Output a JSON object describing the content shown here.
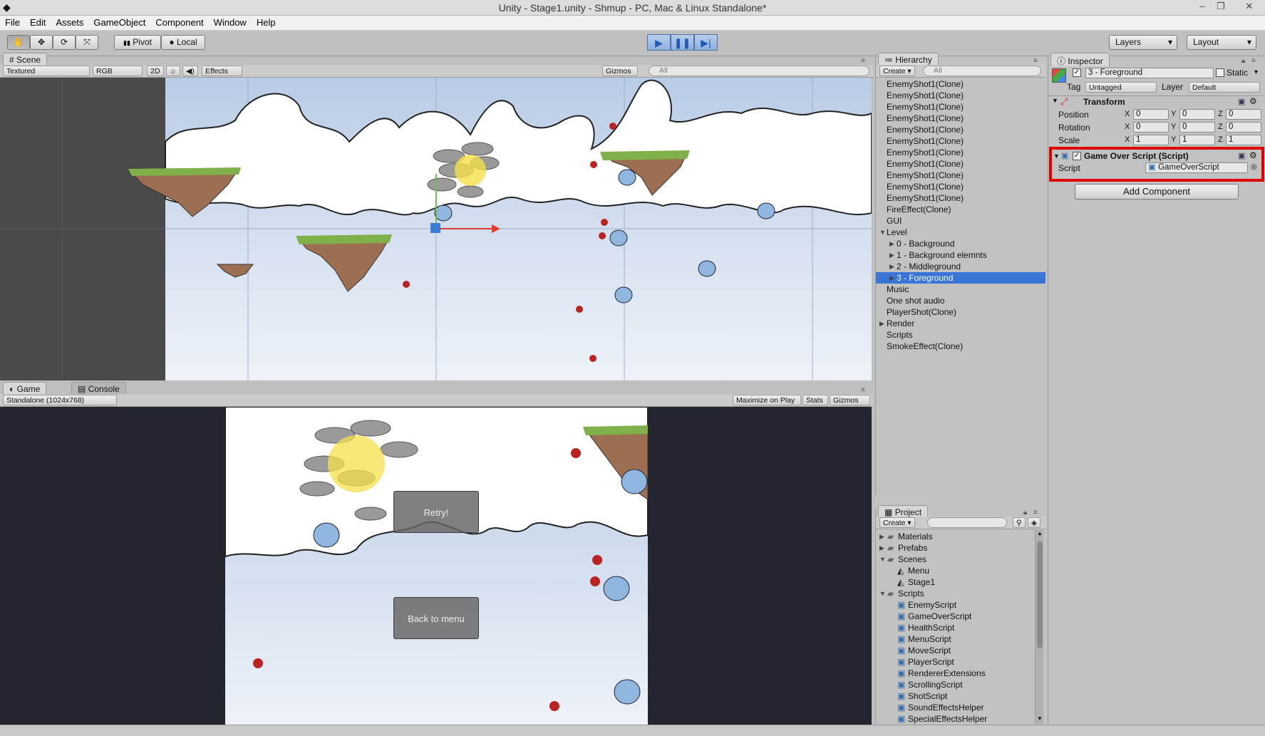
{
  "window": {
    "title": "Unity - Stage1.unity - Shmup - PC, Mac & Linux Standalone*"
  },
  "menu": [
    "File",
    "Edit",
    "Assets",
    "GameObject",
    "Component",
    "Window",
    "Help"
  ],
  "toolbar": {
    "pivot": "Pivot",
    "local": "Local",
    "layers": "Layers",
    "layout": "Layout"
  },
  "scene": {
    "tab": "Scene",
    "render_mode": "Textured",
    "color_mode": "RGB",
    "mode_2d": "2D",
    "effects": "Effects",
    "gizmos": "Gizmos",
    "search_placeholder": "All"
  },
  "game": {
    "tab": "Game",
    "console_tab": "Console",
    "resolution": "Standalone (1024x768)",
    "maximize": "Maximize on Play",
    "stats": "Stats",
    "gizmos": "Gizmos",
    "retry": "Retry!",
    "back": "Back to menu"
  },
  "hierarchy": {
    "tab": "Hierarchy",
    "create": "Create",
    "search_placeholder": "All",
    "items": [
      {
        "label": "EnemyShot1(Clone)",
        "indent": 0
      },
      {
        "label": "EnemyShot1(Clone)",
        "indent": 0
      },
      {
        "label": "EnemyShot1(Clone)",
        "indent": 0
      },
      {
        "label": "EnemyShot1(Clone)",
        "indent": 0
      },
      {
        "label": "EnemyShot1(Clone)",
        "indent": 0
      },
      {
        "label": "EnemyShot1(Clone)",
        "indent": 0
      },
      {
        "label": "EnemyShot1(Clone)",
        "indent": 0
      },
      {
        "label": "EnemyShot1(Clone)",
        "indent": 0
      },
      {
        "label": "EnemyShot1(Clone)",
        "indent": 0
      },
      {
        "label": "EnemyShot1(Clone)",
        "indent": 0
      },
      {
        "label": "EnemyShot1(Clone)",
        "indent": 0
      },
      {
        "label": "FireEffect(Clone)",
        "indent": 0
      },
      {
        "label": "GUI",
        "indent": 0
      },
      {
        "label": "Level",
        "indent": 0,
        "expanded": true
      },
      {
        "label": "0 - Background",
        "indent": 1,
        "collapsed": true
      },
      {
        "label": "1 - Background elemnts",
        "indent": 1,
        "collapsed": true
      },
      {
        "label": "2 - Middleground",
        "indent": 1,
        "collapsed": true
      },
      {
        "label": "3 - Foreground",
        "indent": 1,
        "collapsed": true,
        "selected": true
      },
      {
        "label": "Music",
        "indent": 0
      },
      {
        "label": "One shot audio",
        "indent": 0
      },
      {
        "label": "PlayerShot(Clone)",
        "indent": 0
      },
      {
        "label": "Render",
        "indent": 0,
        "collapsed": true
      },
      {
        "label": "Scripts",
        "indent": 0
      },
      {
        "label": "SmokeEffect(Clone)",
        "indent": 0
      }
    ]
  },
  "project": {
    "tab": "Project",
    "create": "Create",
    "items": [
      {
        "label": "Materials",
        "type": "folder",
        "indent": 0,
        "collapsed": true
      },
      {
        "label": "Prefabs",
        "type": "folder",
        "indent": 0,
        "collapsed": true
      },
      {
        "label": "Scenes",
        "type": "folder",
        "indent": 0,
        "expanded": true
      },
      {
        "label": "Menu",
        "type": "scene",
        "indent": 1
      },
      {
        "label": "Stage1",
        "type": "scene",
        "indent": 1
      },
      {
        "label": "Scripts",
        "type": "folder",
        "indent": 0,
        "expanded": true
      },
      {
        "label": "EnemyScript",
        "type": "script",
        "indent": 1
      },
      {
        "label": "GameOverScript",
        "type": "script",
        "indent": 1
      },
      {
        "label": "HealthScript",
        "type": "script",
        "indent": 1
      },
      {
        "label": "MenuScript",
        "type": "script",
        "indent": 1
      },
      {
        "label": "MoveScript",
        "type": "script",
        "indent": 1
      },
      {
        "label": "PlayerScript",
        "type": "script",
        "indent": 1
      },
      {
        "label": "RendererExtensions",
        "type": "script",
        "indent": 1
      },
      {
        "label": "ScrollingScript",
        "type": "script",
        "indent": 1
      },
      {
        "label": "ShotScript",
        "type": "script",
        "indent": 1
      },
      {
        "label": "SoundEffectsHelper",
        "type": "script",
        "indent": 1
      },
      {
        "label": "SpecialEffectsHelper",
        "type": "script",
        "indent": 1
      }
    ]
  },
  "inspector": {
    "tab": "Inspector",
    "object_name": "3 - Foreground",
    "static": "Static",
    "tag_label": "Tag",
    "tag": "Untagged",
    "layer_label": "Layer",
    "layer": "Default",
    "transform": {
      "title": "Transform",
      "position": {
        "label": "Position",
        "x": "0",
        "y": "0",
        "z": "0"
      },
      "rotation": {
        "label": "Rotation",
        "x": "0",
        "y": "0",
        "z": "0"
      },
      "scale": {
        "label": "Scale",
        "x": "1",
        "y": "1",
        "z": "1"
      }
    },
    "script_component": {
      "title": "Game Over Script (Script)",
      "script_label": "Script",
      "script": "GameOverScript"
    },
    "add_component": "Add Component",
    "axis": {
      "x": "X",
      "y": "Y",
      "z": "Z"
    }
  },
  "colors": {
    "selection": "#3875d7",
    "highlight_box": "#e00000",
    "play_accent": "#1e5ab7"
  }
}
